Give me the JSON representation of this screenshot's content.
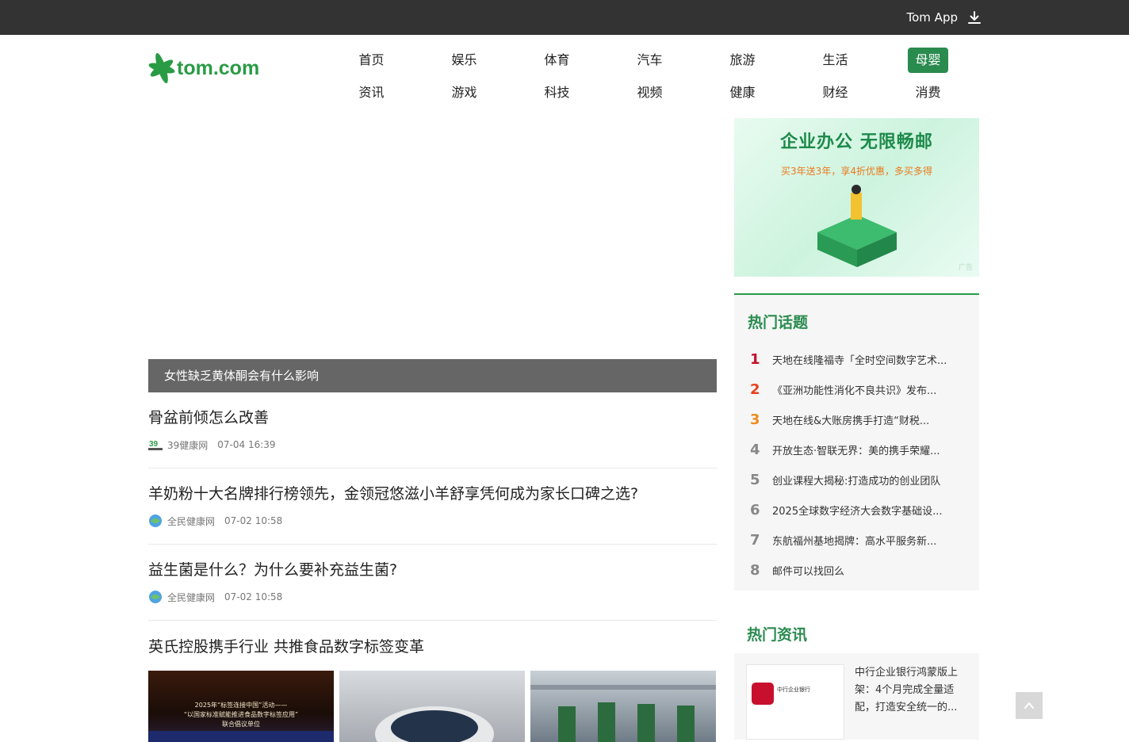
{
  "topbar": {
    "app_label": "Tom App",
    "app_icon": "download-icon"
  },
  "brand": {
    "logo_text": "tom.com",
    "accent": "#2a9b45"
  },
  "nav": {
    "row1": [
      "首页",
      "娱乐",
      "体育",
      "汽车",
      "旅游",
      "生活",
      "母婴"
    ],
    "row2": [
      "资讯",
      "游戏",
      "科技",
      "视频",
      "健康",
      "财经",
      "消费"
    ],
    "active": "母婴"
  },
  "featured": {
    "caption": "女性缺乏黄体酮会有什么影响"
  },
  "news": [
    {
      "title": "骨盆前倾怎么改善",
      "source": "39健康网",
      "time": "07-04 16:39"
    },
    {
      "title": "羊奶粉十大名牌排行榜领先，金领冠悠滋小羊舒享凭何成为家长口碑之选?",
      "source": "全民健康网",
      "time": "07-02 10:58"
    },
    {
      "title": "益生菌是什么？为什么要补充益生菌?",
      "source": "全民健康网",
      "time": "07-02 10:58"
    },
    {
      "title": "英氏控股携手行业 共推食品数字标签变革"
    }
  ],
  "pic1_text": [
    "2025年“标签连接中国”活动——",
    "“以国家标准赋能推进食品数字标签应用”",
    "联合倡议单位"
  ],
  "ad": {
    "title": "企业办公 无限畅邮",
    "subtitle": "买3年送3年，享4折优惠，多买多得",
    "mark": "广告"
  },
  "hot_topics": {
    "heading": "热门话题",
    "items": [
      "天地在线隆福寺「全时空间数字艺术...",
      "《亚洲功能性消化不良共识》发布...",
      "天地在线&大账房携手打造“财税...",
      "开放生态·智联无界：美的携手荣耀...",
      "创业课程大揭秘:打造成功的创业团队",
      "2025全球数字经济大会数字基础设...",
      "东航福州基地揭牌：高水平服务新...",
      "邮件可以找回么"
    ]
  },
  "hot_news": {
    "heading": "热门资讯",
    "item_text": "中行企业银行鸿蒙版上架：4个月完成全量适配，打造安全统一的...",
    "thumb_label": "中行企业银行"
  }
}
